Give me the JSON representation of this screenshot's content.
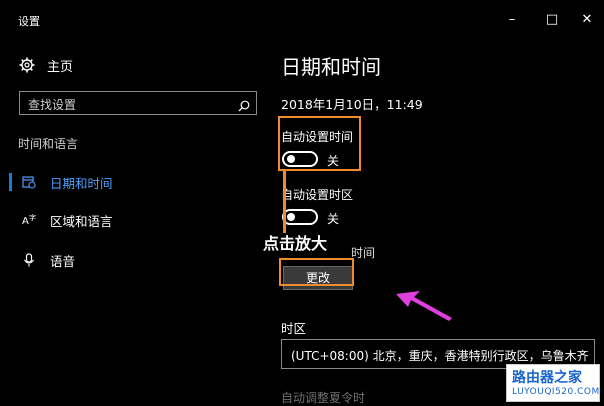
{
  "window": {
    "title": "设置",
    "controls": {
      "minimize": "–",
      "maximize": "□",
      "close": "✕"
    }
  },
  "sidebar": {
    "home_label": "主页",
    "search_placeholder": "查找设置",
    "section_title": "时间和语言",
    "items": [
      {
        "label": "日期和时间",
        "icon": "calendar-clock-icon",
        "active": true
      },
      {
        "label": "区域和语言",
        "icon": "language-icon",
        "active": false
      },
      {
        "label": "语音",
        "icon": "microphone-icon",
        "active": false
      }
    ]
  },
  "main": {
    "title": "日期和时间",
    "current_datetime": "2018年1月10日，11:49",
    "auto_time": {
      "label": "自动设置时间",
      "state": "关"
    },
    "auto_timezone": {
      "label": "自动设置时区",
      "state": "关"
    },
    "change_time": {
      "label_visible_tail": "时间",
      "button": "更改"
    },
    "overlay_text": "点击放大",
    "timezone": {
      "label": "时区",
      "value": "(UTC+08:00) 北京，重庆，香港特别行政区，乌鲁木齐"
    },
    "dst_label": "自动调整夏令时"
  },
  "annotations": {
    "highlight_color": "#f08a2c",
    "arrow_color": "#e040e0"
  },
  "watermark": {
    "cn": "路由器之家",
    "en": "LUYOUQI520.COM"
  }
}
